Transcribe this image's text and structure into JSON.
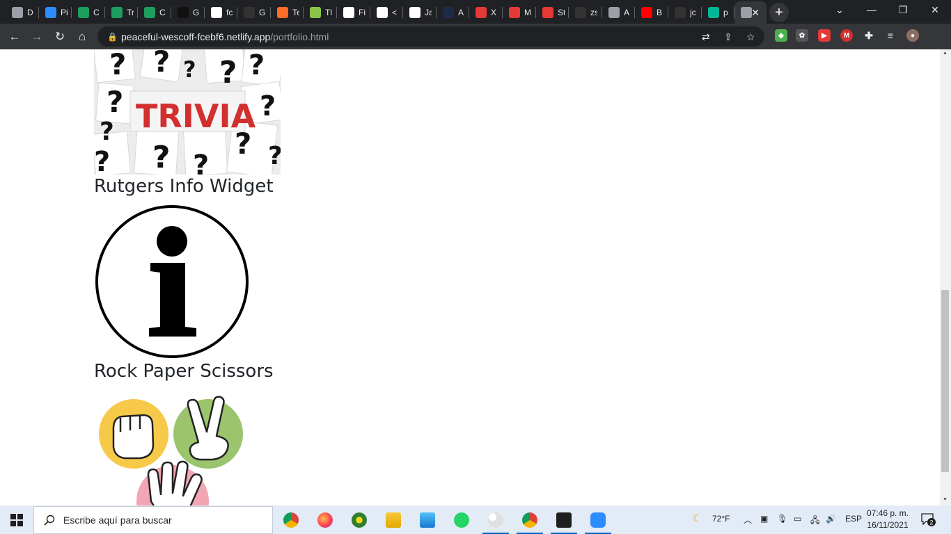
{
  "browser": {
    "tabs": [
      {
        "label": "D",
        "icon": "globe-icon",
        "color": "#9aa0a6"
      },
      {
        "label": "Pi",
        "icon": "zoom-icon",
        "color": "#2d8cff"
      },
      {
        "label": "C",
        "icon": "w-logo-icon",
        "color": "#1d9d5e"
      },
      {
        "label": "Tr",
        "icon": "w-logo-icon",
        "color": "#1d9d5e"
      },
      {
        "label": "C",
        "icon": "w-logo-icon",
        "color": "#1d9d5e"
      },
      {
        "label": "G",
        "icon": "hat-icon",
        "color": "#111111"
      },
      {
        "label": "fc",
        "icon": "speech-icon",
        "color": "#ffffff"
      },
      {
        "label": "G",
        "icon": "github-icon",
        "color": "#333333"
      },
      {
        "label": "Te",
        "icon": "gitlab-icon",
        "color": "#fc6d26"
      },
      {
        "label": "Tl",
        "icon": "leaf-icon",
        "color": "#8bc34a"
      },
      {
        "label": "Fi",
        "icon": "document-icon",
        "color": "#ffffff"
      },
      {
        "label": "<",
        "icon": "speech-icon",
        "color": "#ffffff"
      },
      {
        "label": "Ja",
        "icon": "medium-icon",
        "color": "#ffffff"
      },
      {
        "label": "A",
        "icon": "regex-icon",
        "color": "#1e2a4a"
      },
      {
        "label": "X",
        "icon": "calendar-icon",
        "color": "#e53935"
      },
      {
        "label": "M",
        "icon": "calendar-icon",
        "color": "#e53935"
      },
      {
        "label": "St",
        "icon": "calendar-icon",
        "color": "#e53935"
      },
      {
        "label": "zs",
        "icon": "github-icon",
        "color": "#333333"
      },
      {
        "label": "A",
        "icon": "globe-icon",
        "color": "#9aa0a6"
      },
      {
        "label": "B",
        "icon": "youtube-icon",
        "color": "#ff0000"
      },
      {
        "label": "jc",
        "icon": "github-icon",
        "color": "#333333"
      },
      {
        "label": "p",
        "icon": "diamond-icon",
        "color": "#00b894"
      },
      {
        "label": "",
        "icon": "globe-icon",
        "color": "#9aa0a6",
        "active": true
      }
    ],
    "url_host": "peaceful-wescoff-fcebf6.netlify.app",
    "url_path": "/portfolio.html"
  },
  "page": {
    "trivia_text": "TRIVIA",
    "projects": [
      {
        "title": "Rutgers Info Widget"
      },
      {
        "title": "Rock Paper Scissors"
      }
    ]
  },
  "taskbar": {
    "search_placeholder": "Escribe aquí para buscar",
    "apps": [
      {
        "icon": "chrome-icon",
        "running": false
      },
      {
        "icon": "firefox-icon",
        "running": false
      },
      {
        "icon": "globe-app-icon",
        "running": false
      },
      {
        "icon": "file-explorer-icon",
        "running": false
      },
      {
        "icon": "control-panel-icon",
        "running": false
      },
      {
        "icon": "whatsapp-icon",
        "running": false
      },
      {
        "icon": "paint-icon",
        "running": true
      },
      {
        "icon": "chrome-icon",
        "running": true
      },
      {
        "icon": "terminal-icon",
        "running": true
      },
      {
        "icon": "zoom-icon",
        "running": true
      }
    ],
    "weather": "72°F",
    "language": "ESP",
    "time": "07:46 p. m.",
    "date": "16/11/2021",
    "notifications": "2"
  }
}
